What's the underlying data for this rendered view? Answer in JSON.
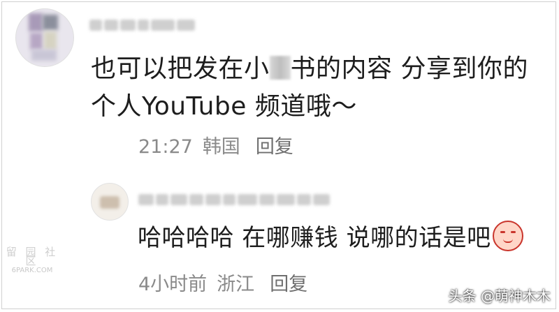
{
  "comment": {
    "text_before_mask": "也可以把发在小",
    "text_after_mask": "书的内容 分享到你的",
    "text_line2": "个人YouTube 频道哦～",
    "time": "21:27",
    "location": "韩国",
    "reply_label": "回复"
  },
  "reply": {
    "text": "哈哈哈哈 在哪赚钱 说哪的话是吧",
    "emoji_icon": "blushing-face-icon",
    "time": "4小时前",
    "location": "浙江",
    "reply_label": "回复"
  },
  "watermark_left": {
    "line1": "留 园 社 区",
    "line2": "6PARK.COM"
  },
  "watermark_right": "头条 @萌神木木"
}
